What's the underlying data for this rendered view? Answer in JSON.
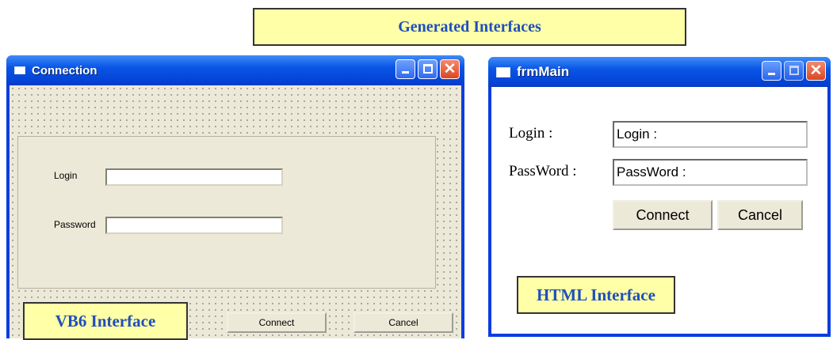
{
  "banner": "Generated Interfaces",
  "vb_window": {
    "title": "Connection",
    "login_label": "Login",
    "password_label": "Password",
    "login_value": "",
    "password_value": "",
    "connect_label": "Connect",
    "cancel_label": "Cancel",
    "caption": "VB6 Interface"
  },
  "html_window": {
    "title": "frmMain",
    "login_label": "Login :",
    "password_label": "PassWord :",
    "login_value": "Login :",
    "password_value": "PassWord :",
    "connect_label": "Connect",
    "cancel_label": "Cancel",
    "caption": "HTML Interface"
  },
  "icons": [
    "window-icon",
    "minimize-icon",
    "maximize-icon",
    "close-icon"
  ],
  "colors": {
    "caption_bg": "#ffffa8",
    "caption_text": "#1f4fbd",
    "titlebar": "#0a55e6",
    "vb_client": "#ece9d8"
  }
}
